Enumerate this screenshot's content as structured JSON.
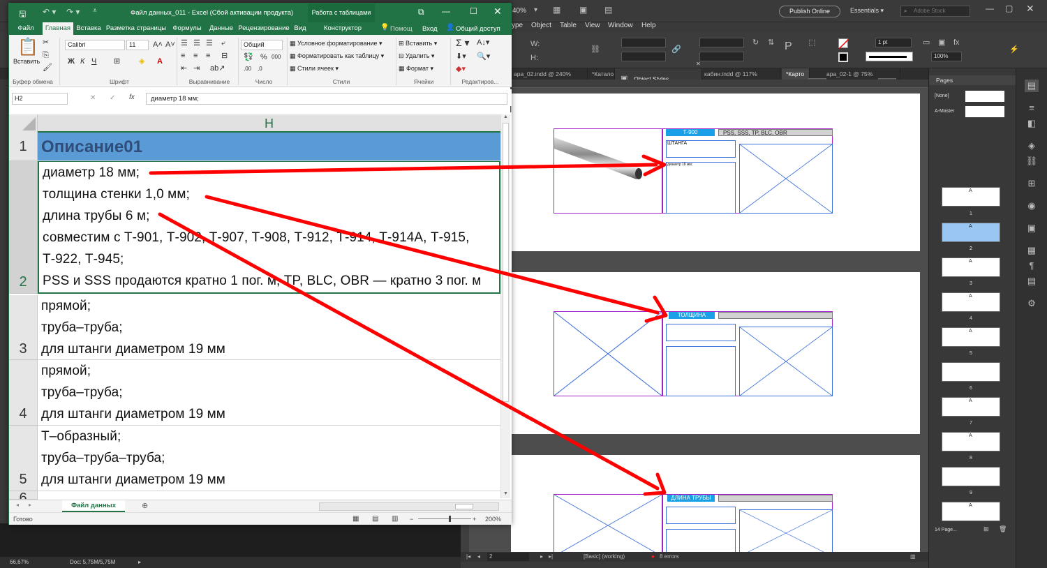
{
  "excel": {
    "title": "Файл данных_011 - Excel (Сбой активации продукта)",
    "context_tab": "Работа с таблицами",
    "tabs": [
      "Файл",
      "Главная",
      "Вставка",
      "Разметка страницы",
      "Формулы",
      "Данные",
      "Рецензирование",
      "Вид",
      "Конструктор"
    ],
    "help_label": "Помощ",
    "signin_label": "Вход",
    "share_label": "Общий доступ",
    "ribbon": {
      "paste_label": "Вставить",
      "clipboard_group": "Буфер обмена",
      "font_name": "Calibri",
      "font_size": "11",
      "font_group": "Шрифт",
      "align_group": "Выравнивание",
      "number_format": "Общий",
      "number_group": "Число",
      "cond_format": "Условное форматирование",
      "format_table": "Форматировать как таблицу",
      "cell_styles": "Стили ячеек",
      "styles_group": "Стили",
      "insert_cells": "Вставить",
      "delete_cells": "Удалить",
      "format_cells": "Формат",
      "cells_group": "Ячейки",
      "editing_group": "Редактиров...",
      "bold": "Ж",
      "italic": "К",
      "underline": "Ч"
    },
    "name_box": "H2",
    "fx": "fx",
    "formula": "диаметр 18 мм;",
    "column_letter": "H",
    "rows": [
      {
        "num": "1",
        "lines": [
          "Описание01"
        ]
      },
      {
        "num": "2",
        "lines": [
          "диаметр 18 мм;",
          "толщина стенки 1,0 мм;",
          "длина трубы 6 м;",
          "совместим с Т-901, Т-902, Т-907, Т-908, Т-912, Т-914, Т-914А, Т-915,",
          "Т-922, Т-945;",
          "PSS и SSS продаются кратно 1 пог. м, TP, BLC, OBR — кратно 3 пог. м"
        ]
      },
      {
        "num": "3",
        "lines": [
          "прямой;",
          "труба–труба;",
          "для штанги диаметром 19 мм"
        ]
      },
      {
        "num": "4",
        "lines": [
          "прямой;",
          "труба–труба;",
          "для штанги диаметром 19 мм"
        ]
      },
      {
        "num": "5",
        "lines": [
          "Т–образный;",
          "труба–труба–труба;",
          "для штанги диаметром 19 мм"
        ]
      },
      {
        "num": "6",
        "lines": [
          ""
        ]
      }
    ],
    "sheet_tab": "Файл данных",
    "status_ready": "Готово",
    "zoom": "200%"
  },
  "indesign": {
    "menus": [
      "ype",
      "Object",
      "Table",
      "View",
      "Window",
      "Help"
    ],
    "publish_online": "Publish Online",
    "workspace": "Essentials",
    "search_placeholder": "Adobe Stock",
    "zoom_pct": "40%",
    "stroke_weight": "1 pt",
    "scale_pct": "100%",
    "doc_tabs": [
      "ара_02.indd @ 240%",
      "*Катало",
      "кабин.indd @ 117%",
      "*Карто",
      "ара_02-1 @ 75%"
    ],
    "object_styles": "Object Styles",
    "frame1": {
      "code": "Т-900",
      "header": "PSS, SSS, TP, BLC, OBR",
      "label": "ШТАНГА",
      "small": "диаметр 18 мм;"
    },
    "frame2": {
      "label": "ТОЛЩИНА"
    },
    "frame3": {
      "label": "ДЛИНА ТРУБЫ"
    },
    "status_page": "2",
    "status_style": "[Basic] (working)",
    "status_errors": "8 errors",
    "bottom_zoom": "66,67%",
    "bottom_doc": "Doc: 5,75M/5,75M"
  },
  "pages_panel": {
    "title": "Pages",
    "none_label": "[None]",
    "master_label": "A-Master",
    "page_numbers": [
      "1",
      "2",
      "3",
      "4",
      "5",
      "6",
      "7",
      "8",
      "9"
    ],
    "master_letter": "A",
    "footer": "14 Page..."
  },
  "colors": {
    "excel_green": "#217346",
    "header_blue": "#5b9bd5",
    "arrow_red": "#ff0000",
    "frame_blue": "#3b6fd8",
    "label_cyan": "#1aa0e6"
  }
}
